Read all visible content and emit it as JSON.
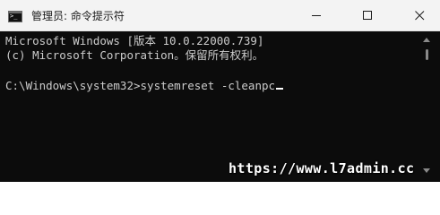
{
  "window": {
    "title": "管理员: 命令提示符",
    "icon": "cmd-icon",
    "icon_glyph": ">_"
  },
  "controls": {
    "minimize_icon": "minimize-icon",
    "maximize_icon": "maximize-icon",
    "close_icon": "close-icon"
  },
  "console": {
    "lines": [
      "Microsoft Windows [版本 10.0.22000.739]",
      "(c) Microsoft Corporation。保留所有权利。",
      "",
      "C:\\Windows\\system32>systemreset -cleanpc"
    ],
    "background_color": "#0c0c0c",
    "text_color": "#cccccc"
  },
  "watermark": {
    "text": "https://www.l7admin.cc"
  }
}
